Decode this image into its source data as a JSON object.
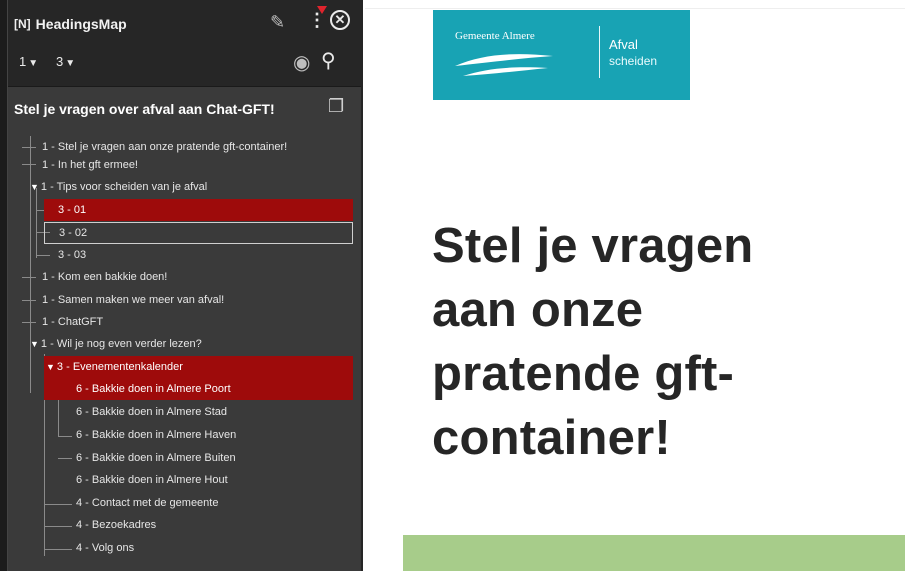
{
  "sidebar": {
    "app_title": "HeadingsMap",
    "app_icon": "[N]",
    "icons": {
      "pin": "pin-icon",
      "menu": "kebab-menu-icon",
      "close": "close-icon",
      "eye": "eye-icon",
      "search": "search-icon",
      "copy": "copy-icon"
    },
    "level_filter_1": "1",
    "level_filter_2": "3",
    "document_title": "Stel je vragen over afval aan Chat-GFT!",
    "tree": [
      {
        "label": "1 - Stel je vragen aan onze pratende gft-container!"
      },
      {
        "label": "1 - In het gft ermee!"
      },
      {
        "label": "1 - Tips voor scheiden van je afval"
      },
      {
        "label": "3 - 01"
      },
      {
        "label": "3 - 02"
      },
      {
        "label": "3 - 03"
      },
      {
        "label": "1 - Kom een bakkie doen!"
      },
      {
        "label": "1 - Samen maken we meer van afval!"
      },
      {
        "label": "1 - ChatGFT"
      },
      {
        "label": "1 - Wil je nog even verder lezen?"
      },
      {
        "label": "3 - Evenementenkalender"
      },
      {
        "label": "6 - Bakkie doen in Almere Poort"
      },
      {
        "label": "6 - Bakkie doen in Almere Stad"
      },
      {
        "label": "6 - Bakkie doen in Almere Haven"
      },
      {
        "label": "6 - Bakkie doen in Almere Buiten"
      },
      {
        "label": "6 - Bakkie doen in Almere Hout"
      },
      {
        "label": "4 - Contact met de gemeente"
      },
      {
        "label": "4 - Bezoekadres"
      },
      {
        "label": "4 - Volg ons"
      }
    ]
  },
  "page": {
    "logo_left": "Gemeente Almere",
    "logo_right_1": "Afval",
    "logo_right_2": "scheiden",
    "headline_lines": [
      "Stel je vragen",
      "aan onze",
      "pratende gft-",
      "container!"
    ]
  },
  "colors": {
    "sidebar_bg": "#3a3a3a",
    "header_bg": "#262626",
    "selected_red": "#9e0b0b",
    "logo_teal": "#18a3b4",
    "band_green": "#a7cc8a",
    "headline": "#262626"
  }
}
